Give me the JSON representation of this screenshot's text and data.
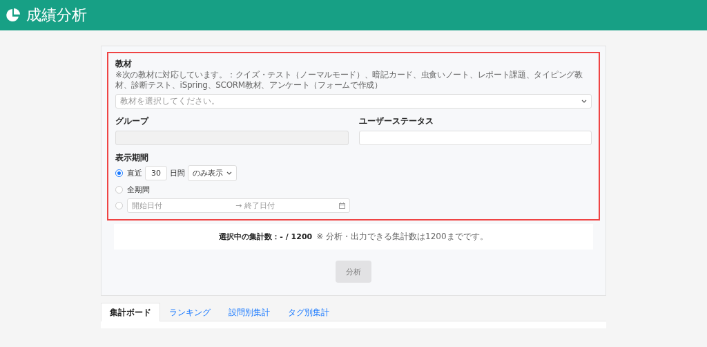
{
  "header": {
    "title": "成績分析"
  },
  "form": {
    "highlighted": true,
    "material": {
      "label": "教材",
      "note": "※次の教材に対応しています。：クイズ・テスト（ノーマルモード）、暗記カード、虫食いノート、レポート課題、タイピング教材、診断テスト、iSpring、SCORM教材、アンケート（フォームで作成）",
      "placeholder": "教材を選択してください。"
    },
    "group": {
      "label": "グループ",
      "disabled": true
    },
    "user_status": {
      "label": "ユーザーステータス",
      "disabled": false
    },
    "period": {
      "label": "表示期間",
      "options": [
        {
          "kind": "recent",
          "selected": true,
          "prefix": "直近",
          "days": "30",
          "unit": "日間",
          "mode": "のみ表示"
        },
        {
          "kind": "all",
          "selected": false,
          "label": "全期間"
        },
        {
          "kind": "range",
          "selected": false,
          "start_placeholder": "開始日付",
          "separator": "→",
          "end_placeholder": "終了日付"
        }
      ]
    }
  },
  "summary": {
    "label": "選択中の集計数：",
    "value": "- / 1200",
    "note": "※ 分析・出力できる集計数は1200までです。"
  },
  "analyze_button": {
    "label": "分析",
    "disabled": true
  },
  "tabs": [
    {
      "label": "集計ボード",
      "selected": true
    },
    {
      "label": "ランキング",
      "selected": false
    },
    {
      "label": "設問別集計",
      "selected": false
    },
    {
      "label": "タグ別集計",
      "selected": false
    }
  ]
}
